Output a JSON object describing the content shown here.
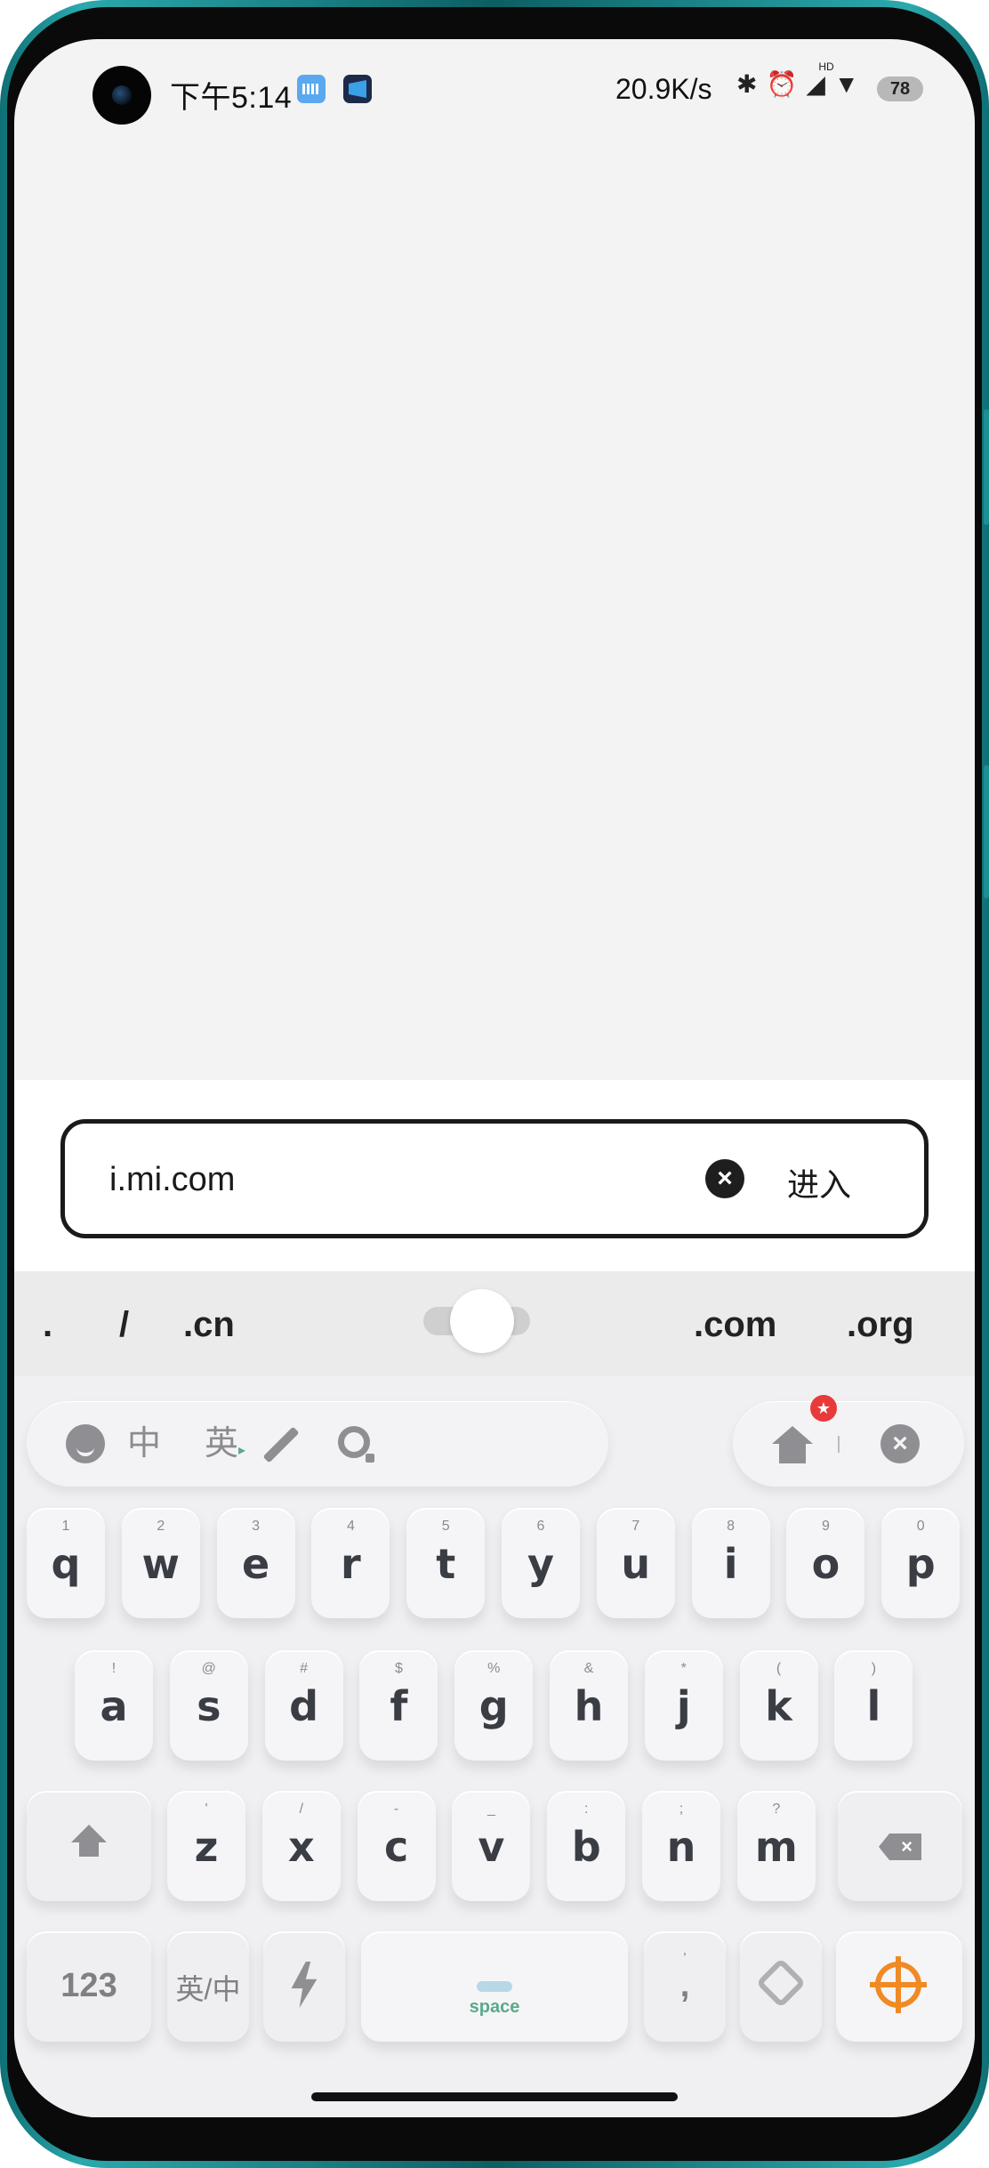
{
  "status_bar": {
    "time": "下午5:14",
    "net_speed": "20.9K/s",
    "hd_label": "HD",
    "battery": "78",
    "icons": [
      "bluetooth-icon",
      "alarm-icon",
      "signal-icon",
      "wifi-icon",
      "battery-icon"
    ]
  },
  "url_bar": {
    "value": "i.mi.com",
    "clear_icon": "clear-circle-icon",
    "go_label": "进入"
  },
  "shortcuts": {
    "items": [
      ".",
      "/",
      ".cn",
      ".com",
      ".org"
    ]
  },
  "toolbar": {
    "chinese_label": "中",
    "english_label": "英",
    "english_marker": "▸",
    "badge_icon": "★",
    "left_icons": [
      "emoji-icon",
      "chinese-mode",
      "english-mode",
      "handwriting-icon",
      "search-icon"
    ],
    "right_icons": [
      "home-icon",
      "close-icon"
    ]
  },
  "keys": {
    "row1": [
      {
        "hint": "1",
        "char": "q"
      },
      {
        "hint": "2",
        "char": "w"
      },
      {
        "hint": "3",
        "char": "e"
      },
      {
        "hint": "4",
        "char": "r"
      },
      {
        "hint": "5",
        "char": "t"
      },
      {
        "hint": "6",
        "char": "y"
      },
      {
        "hint": "7",
        "char": "u"
      },
      {
        "hint": "8",
        "char": "i"
      },
      {
        "hint": "9",
        "char": "o"
      },
      {
        "hint": "0",
        "char": "p"
      }
    ],
    "row2": [
      {
        "hint": "!",
        "char": "a"
      },
      {
        "hint": "@",
        "char": "s"
      },
      {
        "hint": "#",
        "char": "d"
      },
      {
        "hint": "$",
        "char": "f"
      },
      {
        "hint": "%",
        "char": "g"
      },
      {
        "hint": "&",
        "char": "h"
      },
      {
        "hint": "*",
        "char": "j"
      },
      {
        "hint": "(",
        "char": "k"
      },
      {
        "hint": ")",
        "char": "l"
      }
    ],
    "row3": [
      {
        "hint": "'",
        "char": "z"
      },
      {
        "hint": "/",
        "char": "x"
      },
      {
        "hint": "-",
        "char": "c"
      },
      {
        "hint": "_",
        "char": "v"
      },
      {
        "hint": ":",
        "char": "b"
      },
      {
        "hint": ";",
        "char": "n"
      },
      {
        "hint": "?",
        "char": "m"
      }
    ],
    "bottom": {
      "num_label": "123",
      "lang_label": "英/中",
      "space_label": "space",
      "punct_label": ",",
      "punct_hint": "'"
    }
  },
  "colors": {
    "accent_orange": "#f08a24",
    "space_green": "#5aaa8a",
    "badge_red": "#e83a3a"
  }
}
